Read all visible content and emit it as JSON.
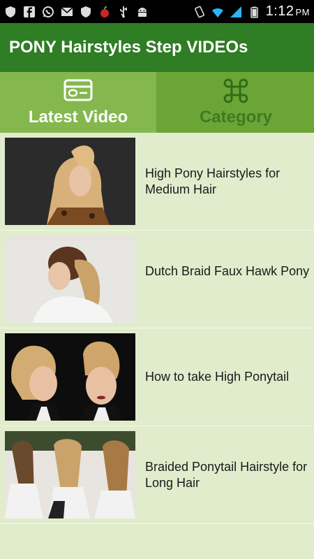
{
  "status_bar": {
    "time": "1:12",
    "ampm": "PM",
    "icons": [
      "shield-icon",
      "facebook-icon",
      "whatsapp-icon",
      "mail-icon",
      "shield-icon",
      "apple-icon",
      "usb-icon",
      "android-icon",
      "vibrate-icon",
      "wifi-icon",
      "signal-icon",
      "battery-icon"
    ]
  },
  "app": {
    "title": "PONY Hairstyles Step VIDEOs"
  },
  "tabs": [
    {
      "label": "Latest Video",
      "icon": "video-card-icon",
      "selected": true
    },
    {
      "label": "Category",
      "icon": "command-icon",
      "selected": false
    }
  ],
  "videos": [
    {
      "title": "High Pony Hairstyles for Medium Hair"
    },
    {
      "title": "Dutch Braid Faux Hawk Pony"
    },
    {
      "title": "How to take High Ponytail"
    },
    {
      "title": "Braided Ponytail Hairstyle for Long Hair"
    }
  ],
  "colors": {
    "app_bar": "#2f7d25",
    "tab_selected": "#84b84e",
    "tab_unselected": "#6aa536",
    "list_background": "#e1eccc"
  }
}
